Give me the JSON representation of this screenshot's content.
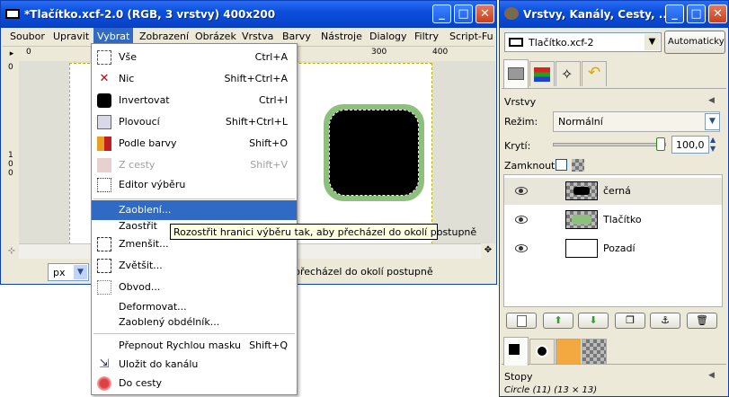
{
  "image_window": {
    "title": "*Tlačítko.xcf-2.0 (RGB, 3 vrstvy) 400x200",
    "menu": [
      "Soubor",
      "Upravit",
      "Vybrat",
      "Zobrazení",
      "Obrázek",
      "Vrstva",
      "Barvy",
      "Nástroje",
      "Dialogy",
      "Filtry",
      "Script-Fu"
    ],
    "active_menu": "Vybrat",
    "ruler_h_labels": [
      "0",
      "300",
      "400"
    ],
    "ruler_v_labels": [
      "0",
      "1",
      "0",
      "0"
    ],
    "unit": "px",
    "status_text": "y přecházel do okolí postupně"
  },
  "select_menu": {
    "items": [
      {
        "label": "Vše",
        "shortcut": "Ctrl+A",
        "icon": "select-all-icon",
        "enabled": true
      },
      {
        "label": "Nic",
        "shortcut": "Shift+Ctrl+A",
        "icon": "select-none-icon",
        "enabled": true
      },
      {
        "label": "Invertovat",
        "shortcut": "Ctrl+I",
        "icon": "invert-icon",
        "enabled": true
      },
      {
        "label": "Plovoucí",
        "shortcut": "Shift+Ctrl+L",
        "icon": "floating-icon",
        "enabled": true
      },
      {
        "label": "Podle barvy",
        "shortcut": "Shift+O",
        "icon": "by-color-icon",
        "enabled": true
      },
      {
        "label": "Z cesty",
        "shortcut": "Shift+V",
        "icon": "from-path-icon",
        "enabled": false
      },
      {
        "label": "Editor výběru",
        "shortcut": "",
        "icon": "selection-editor-icon",
        "enabled": true
      },
      {
        "label": "Zaoblení...",
        "shortcut": "",
        "icon": "",
        "enabled": true,
        "highlighted": true
      },
      {
        "label": "Zaostřit",
        "shortcut": "",
        "icon": "",
        "enabled": true
      },
      {
        "label": "Zmenšit...",
        "shortcut": "",
        "icon": "shrink-icon",
        "enabled": true
      },
      {
        "label": "Zvětšit...",
        "shortcut": "",
        "icon": "grow-icon",
        "enabled": true
      },
      {
        "label": "Obvod...",
        "shortcut": "",
        "icon": "border-icon",
        "enabled": true
      },
      {
        "label": "Deformovat...",
        "shortcut": "",
        "icon": "",
        "enabled": true
      },
      {
        "label": "Zaoblený obdélník...",
        "shortcut": "",
        "icon": "",
        "enabled": true
      },
      {
        "label": "Přepnout Rychlou masku",
        "shortcut": "Shift+Q",
        "icon": "",
        "enabled": true
      },
      {
        "label": "Uložit do kanálu",
        "shortcut": "",
        "icon": "save-channel-icon",
        "enabled": true
      },
      {
        "label": "Do cesty",
        "shortcut": "",
        "icon": "to-path-icon",
        "enabled": true
      }
    ]
  },
  "tooltip": "Rozostřit hranici výběru tak, aby přecházel do okolí postupně",
  "dock": {
    "title": "Vrstvy, Kanály, Cesty, ...",
    "image_combo": "Tlačítko.xcf-2",
    "auto_button": "Automaticky",
    "panel_title": "Vrstvy",
    "mode_label": "Režim:",
    "mode_value": "Normální",
    "opacity_label": "Krytí:",
    "opacity_value": "100,0",
    "opacity_fraction": 1.0,
    "lock_label": "Zamknout:",
    "layers": [
      {
        "name": "černá",
        "selected": true
      },
      {
        "name": "Tlačítko",
        "selected": false
      },
      {
        "name": "Pozadí",
        "selected": false
      }
    ],
    "brushes_title": "Stopy",
    "brush_info": "Circle (11) (13 × 13)"
  }
}
